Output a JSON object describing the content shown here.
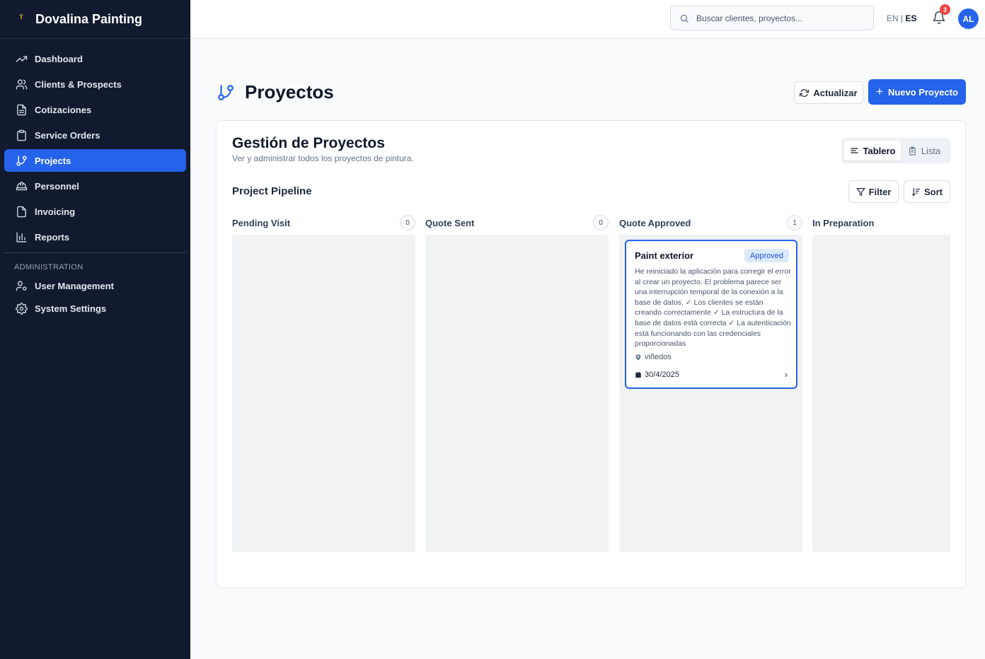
{
  "app": {
    "brand": "Dovalina Painting"
  },
  "sidebar": {
    "items": [
      {
        "label": "Dashboard",
        "icon": "trending-up-icon"
      },
      {
        "label": "Clients & Prospects",
        "icon": "users-icon"
      },
      {
        "label": "Cotizaciones",
        "icon": "file-text-icon"
      },
      {
        "label": "Service Orders",
        "icon": "clipboard-icon"
      },
      {
        "label": "Projects",
        "icon": "git-branch-icon",
        "active": true
      },
      {
        "label": "Personnel",
        "icon": "hard-hat-icon"
      },
      {
        "label": "Invoicing",
        "icon": "file-icon"
      },
      {
        "label": "Reports",
        "icon": "bar-chart-icon"
      }
    ],
    "admin_section": "ADMINISTRATION",
    "admin_items": [
      {
        "label": "User Management",
        "icon": "user-cog-icon"
      },
      {
        "label": "System Settings",
        "icon": "settings-icon"
      }
    ]
  },
  "header": {
    "search_placeholder": "Buscar clientes, proyectos...",
    "lang_en": "EN",
    "lang_sep": "|",
    "lang_es": "ES",
    "notification_count": "3",
    "avatar_initials": "AL"
  },
  "page": {
    "title": "Proyectos",
    "refresh_label": "Actualizar",
    "new_label": "Nuevo Proyecto"
  },
  "card": {
    "title": "Gestión de Proyectos",
    "subtitle": "Ver y administrar todos los proyectos de pintura.",
    "view_board": "Tablero",
    "view_list": "Lista",
    "pipeline_title": "Project Pipeline",
    "filter_label": "Filter",
    "sort_label": "Sort"
  },
  "columns": [
    {
      "name": "Pending Visit",
      "count": "0"
    },
    {
      "name": "Quote Sent",
      "count": "0"
    },
    {
      "name": "Quote Approved",
      "count": "1"
    },
    {
      "name": "In Preparation",
      "count": ""
    }
  ],
  "project_card": {
    "title": "Paint exterior",
    "status": "Approved",
    "description": "He reiniciado la aplicación para corregir el error al crear un proyecto. El problema parece ser una interrupción temporal de la conexión a la base de datos. ✓ Los clientes se están creando correctamente ✓ La estructura de la base de datos está correcta ✓ La autenticación está funcionando con las credenciales proporcionadas",
    "location": "viñedos",
    "date": "30/4/2025"
  },
  "colors": {
    "sidebar_bg": "#111a2e",
    "accent": "#2563eb",
    "badge_bg": "#dbeafe",
    "notification": "#ef4444"
  }
}
